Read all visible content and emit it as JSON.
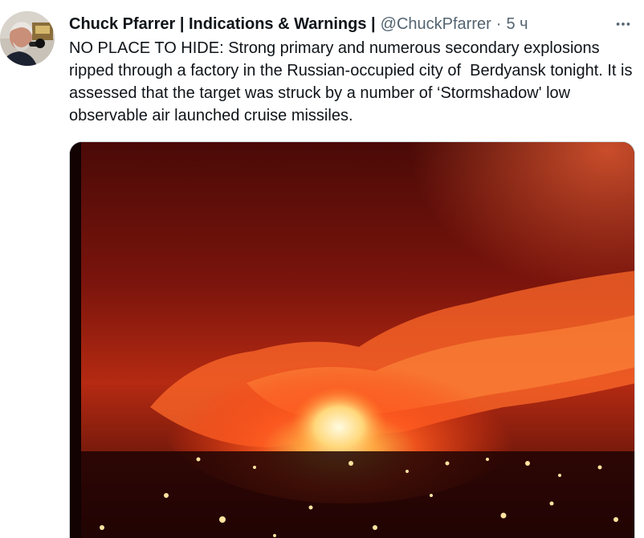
{
  "tweet": {
    "author_name": "Chuck Pfarrer | Indications & Warnings |",
    "handle": "@ChuckPfarrer",
    "separator": "·",
    "timestamp": "5 ч",
    "text": "NO PLACE TO HIDE: Strong primary and numerous secondary explosions ripped through a factory in the Russian-occupied city of  Berdyansk tonight. It is assessed that the target was struck by a number of ‘Stormshadow' low observable air launched cruise missiles."
  },
  "icons": {
    "more": "more-horizontal-icon"
  },
  "colors": {
    "text_primary": "#0f1419",
    "text_secondary": "#536471",
    "border": "#cfd9de"
  }
}
